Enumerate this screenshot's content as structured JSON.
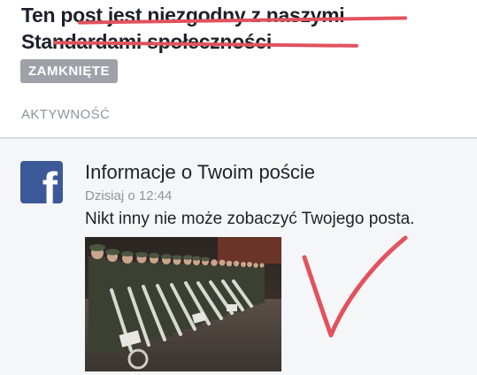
{
  "post": {
    "title": "Ten post jest niezgodny z naszymi Standardami społeczności",
    "status_badge": "ZAMKNIĘTE",
    "section_label": "AKTYWNOŚĆ"
  },
  "notification": {
    "icon": "facebook-logo-icon",
    "title": "Informacje o Twoim poście",
    "time": "Dzisiaj o 12:44",
    "message": "Nikt inny nie może zobaczyć Twojego posta."
  },
  "colors": {
    "strike": "#e2525e",
    "badge": "#9ea2a8",
    "facebook_blue": "#3b5998",
    "card_bg": "#f5f6f7"
  }
}
